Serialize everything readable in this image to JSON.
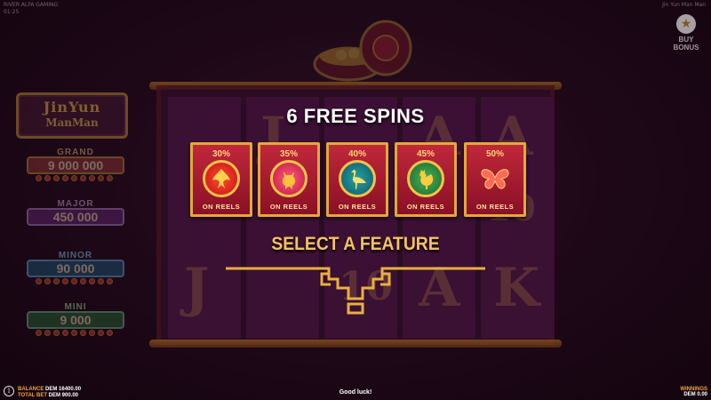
{
  "topbar": {
    "studio": "RIVER ALFA GAMING",
    "time": "01:25",
    "game_title": "Jin Yun Man Man"
  },
  "buy_bonus": {
    "label_line1": "BUY",
    "label_line2": "BONUS",
    "icon": "star-icon"
  },
  "logo": {
    "line1": "JinYun",
    "line2": "ManMan"
  },
  "jackpots": [
    {
      "name": "GRAND",
      "amount": "9 000 000"
    },
    {
      "name": "MAJOR",
      "amount": "450 000"
    },
    {
      "name": "MINOR",
      "amount": "90 000"
    },
    {
      "name": "MINI",
      "amount": "9 000"
    }
  ],
  "feature_select": {
    "title": "6 FREE SPINS",
    "subtitle": "SELECT A FEATURE",
    "options": [
      {
        "percent": "30%",
        "label": "ON REELS",
        "icon": "phoenix-icon"
      },
      {
        "percent": "35%",
        "label": "ON REELS",
        "icon": "qilin-icon"
      },
      {
        "percent": "40%",
        "label": "ON REELS",
        "icon": "crane-icon"
      },
      {
        "percent": "45%",
        "label": "ON REELS",
        "icon": "rooster-icon"
      },
      {
        "percent": "50%",
        "label": "ON REELS",
        "icon": "butterfly-icon"
      }
    ]
  },
  "reel_symbols": [
    "J",
    "A",
    "A",
    "10",
    "J",
    "10",
    "A",
    "K"
  ],
  "status": {
    "balance_label": "BALANCE",
    "balance_value": "DEM 16400.00",
    "total_bet_label": "TOTAL BET",
    "total_bet_value": "DEM 900.00",
    "message": "Good luck!",
    "winnings_label": "WINNINGS",
    "winnings_value": "DEM 0.00"
  },
  "colors": {
    "gold": "#f4c260",
    "card_red": "#c0283a",
    "card_border": "#e2a93c"
  }
}
